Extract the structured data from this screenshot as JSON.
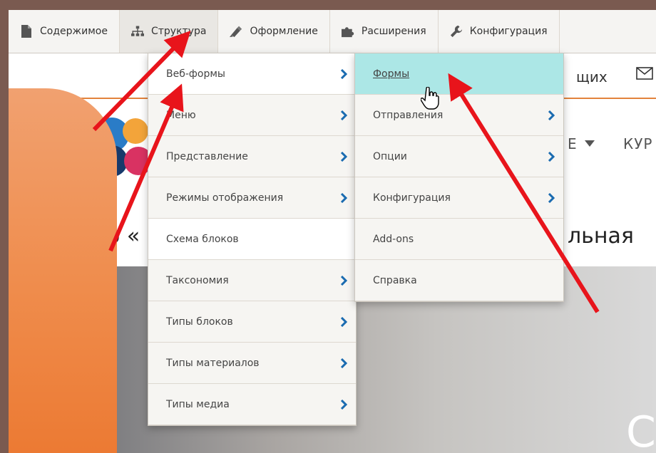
{
  "toolbar": {
    "tabs": [
      {
        "label": "Содержимое",
        "icon": "document-icon"
      },
      {
        "label": "Структура",
        "icon": "structure-icon"
      },
      {
        "label": "Оформление",
        "icon": "brush-icon"
      },
      {
        "label": "Расширения",
        "icon": "puzzle-icon"
      },
      {
        "label": "Конфигурация",
        "icon": "wrench-icon"
      }
    ]
  },
  "page": {
    "second_bar_text": "щих",
    "nav_text": "Е",
    "nav_text2": "КУР",
    "headline_left": "о «",
    "headline_right": "льная",
    "hero_big": "С"
  },
  "menu_primary": [
    {
      "label": "Веб-формы",
      "submenu": true
    },
    {
      "label": "Меню",
      "submenu": true
    },
    {
      "label": "Представление",
      "submenu": true
    },
    {
      "label": "Режимы отображения",
      "submenu": true
    },
    {
      "label": "Схема блоков",
      "submenu": false
    },
    {
      "label": "Таксономия",
      "submenu": true
    },
    {
      "label": "Типы блоков",
      "submenu": true
    },
    {
      "label": "Типы материалов",
      "submenu": true
    },
    {
      "label": "Типы медиа",
      "submenu": true
    }
  ],
  "menu_secondary": [
    {
      "label": "Формы",
      "submenu": false
    },
    {
      "label": "Отправления",
      "submenu": true
    },
    {
      "label": "Опции",
      "submenu": true
    },
    {
      "label": "Конфигурация",
      "submenu": true
    },
    {
      "label": "Add-ons",
      "submenu": false
    },
    {
      "label": "Справка",
      "submenu": false
    }
  ],
  "colors": {
    "highlight": "#ace7e6",
    "chevron": "#1a6bb0",
    "arrow": "#e8141b",
    "accent": "#e2833c"
  }
}
